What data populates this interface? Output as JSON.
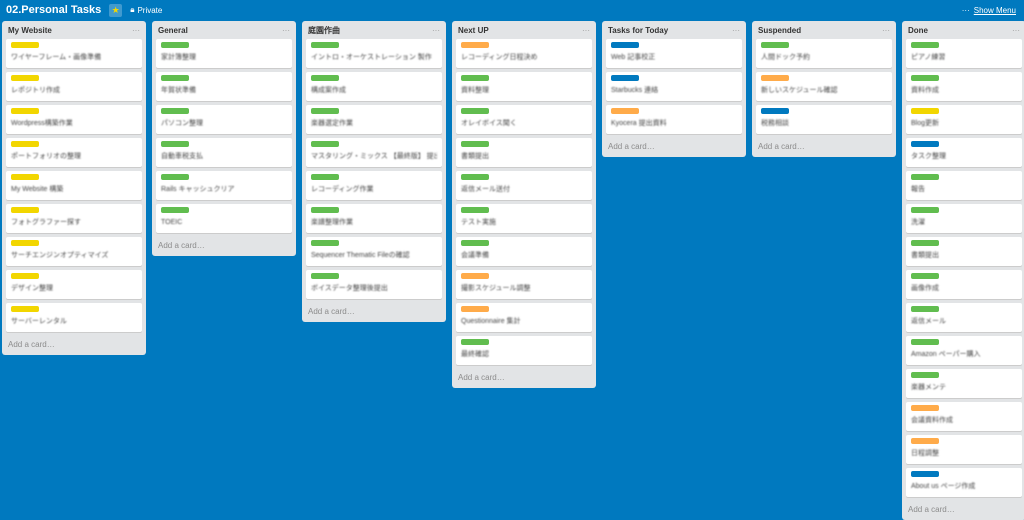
{
  "header": {
    "board_title": "02.Personal Tasks",
    "privacy": "Private",
    "show_menu": "Show Menu"
  },
  "colors": {
    "yellow": "#f2d600",
    "green": "#61bd4f",
    "orange": "#ffab4a",
    "blue": "#0079bf"
  },
  "add_card_label": "Add a card…",
  "lists": [
    {
      "title": "My Website",
      "cards": [
        {
          "label": "yellow",
          "text": "ワイヤーフレーム・画像準備"
        },
        {
          "label": "yellow",
          "text": "レポジトリ作成"
        },
        {
          "label": "yellow",
          "text": "Wordpress構築作業"
        },
        {
          "label": "yellow",
          "text": "ポートフォリオの整理"
        },
        {
          "label": "yellow",
          "text": "My Website 構築"
        },
        {
          "label": "yellow",
          "text": "フォトグラファー探す"
        },
        {
          "label": "yellow",
          "text": "サーチエンジンオプティマイズ"
        },
        {
          "label": "yellow",
          "text": "デザイン整理"
        },
        {
          "label": "yellow",
          "text": "サーバーレンタル"
        }
      ]
    },
    {
      "title": "General",
      "cards": [
        {
          "label": "green",
          "text": "家計簿整理"
        },
        {
          "label": "green",
          "text": "年賀状準備"
        },
        {
          "label": "green",
          "text": "パソコン整理"
        },
        {
          "label": "green",
          "text": "自動車税支払"
        },
        {
          "label": "green",
          "text": "Rails キャッシュクリア"
        },
        {
          "label": "green",
          "text": "TOEIC"
        }
      ]
    },
    {
      "title": "庭園作曲",
      "cards": [
        {
          "label": "green",
          "text": "イントロ・オーケストレーション 製作"
        },
        {
          "label": "green",
          "text": "構成案作成"
        },
        {
          "label": "green",
          "text": "楽器選定作業"
        },
        {
          "label": "green",
          "text": "マスタリング・ミックス 【最終版】 提出"
        },
        {
          "label": "green",
          "text": "レコーディング作業"
        },
        {
          "label": "green",
          "text": "楽譜整理作業"
        },
        {
          "label": "green",
          "text": "Sequencer Thematic Fileの確認"
        },
        {
          "label": "green",
          "text": "ボイスデータ整理後提出"
        }
      ]
    },
    {
      "title": "Next UP",
      "cards": [
        {
          "label": "orange",
          "text": "レコーディング日程決め"
        },
        {
          "label": "green",
          "text": "資料整理"
        },
        {
          "label": "green",
          "text": "オレイボイス聞く"
        },
        {
          "label": "green",
          "text": "書類提出"
        },
        {
          "label": "green",
          "text": "返信メール送付"
        },
        {
          "label": "green",
          "text": "テスト実施"
        },
        {
          "label": "green",
          "text": "会議準備"
        },
        {
          "label": "orange",
          "text": "撮影スケジュール調整"
        },
        {
          "label": "orange",
          "text": "Questionnaire 集計"
        },
        {
          "label": "green",
          "text": "最終確認"
        }
      ]
    },
    {
      "title": "Tasks for Today",
      "cards": [
        {
          "label": "blue",
          "text": "Web 記事校正"
        },
        {
          "label": "blue",
          "text": "Starbucks 連絡"
        },
        {
          "label": "orange",
          "text": "Kyocera 提出資料"
        }
      ]
    },
    {
      "title": "Suspended",
      "cards": [
        {
          "label": "green",
          "text": "人間ドック予約"
        },
        {
          "label": "orange",
          "text": "新しいスケジュール確認"
        },
        {
          "label": "blue",
          "text": "税務相談"
        }
      ]
    },
    {
      "title": "Done",
      "cards": [
        {
          "label": "green",
          "text": "ピアノ練習"
        },
        {
          "label": "green",
          "text": "資料作成"
        },
        {
          "label": "yellow",
          "text": "Blog更新"
        },
        {
          "label": "blue",
          "text": "タスク整理"
        },
        {
          "label": "green",
          "text": "報告"
        },
        {
          "label": "green",
          "text": "洗濯"
        },
        {
          "label": "green",
          "text": "書類提出"
        },
        {
          "label": "green",
          "text": "画像作成"
        },
        {
          "label": "green",
          "text": "返信メール"
        },
        {
          "label": "green",
          "text": "Amazon ペーパー購入"
        },
        {
          "label": "green",
          "text": "楽器メンテ"
        },
        {
          "label": "orange",
          "text": "会議資料作成"
        },
        {
          "label": "orange",
          "text": "日程調整"
        },
        {
          "label": "blue",
          "text": "About us ページ作成"
        }
      ]
    }
  ]
}
